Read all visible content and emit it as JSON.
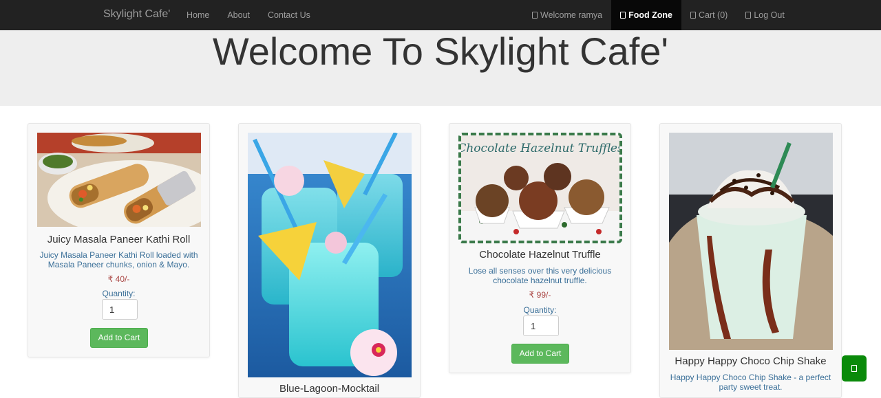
{
  "nav": {
    "brand": "Skylight Cafe'",
    "links": [
      "Home",
      "About",
      "Contact Us"
    ],
    "welcome": "Welcome ramya",
    "food_zone": "Food Zone",
    "cart": "Cart (0)",
    "logout": "Log Out"
  },
  "hero": {
    "title": "Welcome To Skylight Cafe'"
  },
  "products": [
    {
      "name": "Juicy Masala Paneer Kathi Roll",
      "description": "Juicy Masala Paneer Kathi Roll loaded with Masala Paneer chunks, onion & Mayo.",
      "price": "₹ 40/-",
      "quantity_label": "Quantity:",
      "quantity": "1",
      "button": "Add to Cart"
    },
    {
      "name": "Blue-Lagoon-Mocktail"
    },
    {
      "name": "Chocolate Hazelnut Truffle",
      "image_caption": "Chocolate Hazelnut Truffles",
      "description": "Lose all senses over this very delicious chocolate hazelnut truffle.",
      "price": "₹ 99/-",
      "quantity_label": "Quantity:",
      "quantity": "1",
      "button": "Add to Cart"
    },
    {
      "name": "Happy Happy Choco Chip Shake",
      "description": "Happy Happy Choco Chip Shake - a perfect party sweet treat."
    }
  ],
  "colors": {
    "navbar": "#222222",
    "button": "#5cb85c",
    "price": "#a94442",
    "desc": "#3a6f98",
    "chat": "#0a8a0a"
  }
}
